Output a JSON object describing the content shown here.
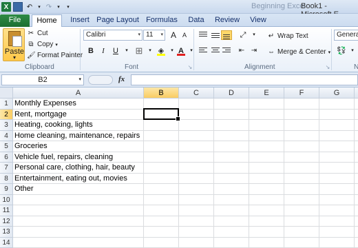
{
  "title": {
    "app_faint": "Beginning Excel",
    "book": "Book1 - Microsoft E"
  },
  "tabs": [
    {
      "label": "File"
    },
    {
      "label": "Home"
    },
    {
      "label": "Insert"
    },
    {
      "label": "Page Layout"
    },
    {
      "label": "Formulas"
    },
    {
      "label": "Data"
    },
    {
      "label": "Review"
    },
    {
      "label": "View"
    }
  ],
  "ribbon": {
    "clipboard": {
      "paste": "Paste",
      "cut": "Cut",
      "copy": "Copy",
      "format_painter": "Format Painter",
      "label": "Clipboard"
    },
    "font": {
      "name": "Calibri",
      "size": "11",
      "bold": "B",
      "italic": "I",
      "underline": "U",
      "grow": "A",
      "shrink": "A",
      "label": "Font",
      "fill_color": "#ffff00",
      "font_color": "#e02020"
    },
    "alignment": {
      "wrap_text": "Wrap Text",
      "merge_center": "Merge & Center",
      "label": "Alignment"
    },
    "number": {
      "format": "General",
      "label": "N"
    }
  },
  "formula_bar": {
    "name_box": "B2",
    "fx": "fx",
    "content": ""
  },
  "grid": {
    "columns": [
      "A",
      "B",
      "C",
      "D",
      "E",
      "F",
      "G"
    ],
    "selected_column": "B",
    "rows": [
      "1",
      "2",
      "3",
      "4",
      "5",
      "6",
      "7",
      "8",
      "9",
      "10",
      "11",
      "12",
      "13",
      "14"
    ],
    "selected_row": "2",
    "active_cell": "B2",
    "cells_a": [
      "Monthly Expenses",
      "Rent, mortgage",
      "Heating, cooking, lights",
      "Home cleaning, maintenance, repairs",
      "Groceries",
      "Vehicle fuel, repairs, cleaning",
      "Personal care, clothing, hair, beauty",
      "Entertainment, eating out, movies",
      "Other"
    ]
  }
}
